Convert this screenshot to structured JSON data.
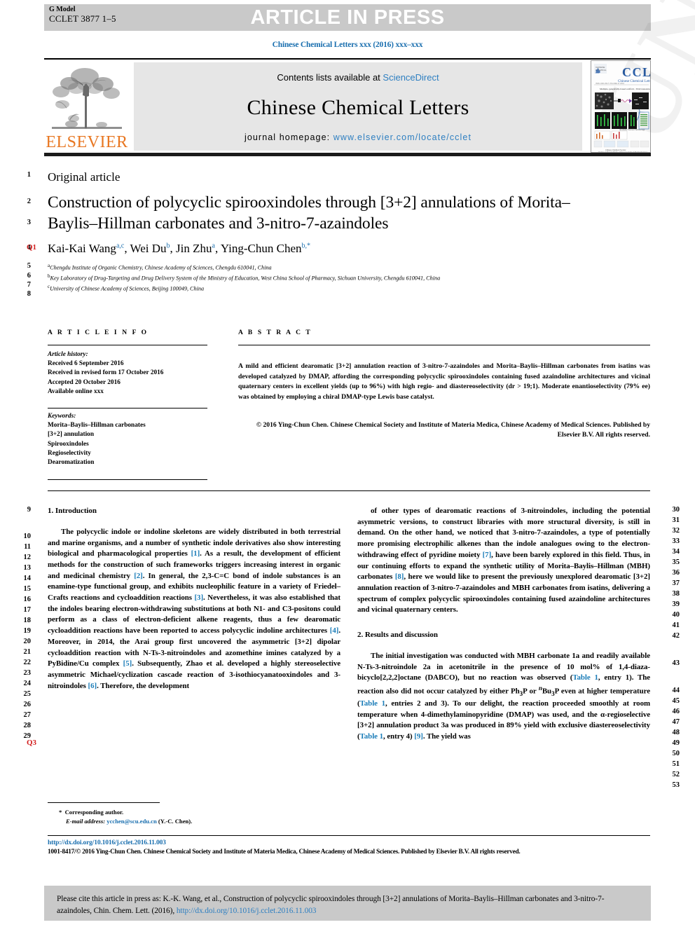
{
  "header": {
    "g_model_label": "G Model",
    "g_model_code": "CCLET 3877 1–5",
    "article_in_press": "ARTICLE IN PRESS",
    "journal_ref": "Chinese Chemical Letters xxx (2016) xxx–xxx"
  },
  "masthead": {
    "contents_prefix": "Contents lists available at ",
    "contents_link": "ScienceDirect",
    "journal_name": "Chinese Chemical Letters",
    "homepage_prefix": "journal homepage: ",
    "homepage_link": "www.elsevier.com/locate/cclet",
    "publisher_logo_text": "ELSEVIER",
    "cover_title": "CCL",
    "cover_subtitle": "Chinese Chemical Letters"
  },
  "article": {
    "type_label": "Original article",
    "title": "Construction of polycyclic spirooxindoles through [3+2] annulations of Morita–Baylis–Hillman carbonates and 3-nitro-7-azaindoles",
    "authors_html": "Kai-Kai Wang<sup>a,c</sup>, Wei Du<sup>b</sup>, Jin Zhu<sup>a</sup>, Ying-Chun Chen<sup>b,*</sup>",
    "affiliations": [
      {
        "marker": "a",
        "text": "Chengdu Institute of Organic Chemistry, Chinese Academy of Sciences, Chengdu 610041, China"
      },
      {
        "marker": "b",
        "text": "Key Laboratory of Drug-Targeting and Drug Delivery System of the Ministry of Education, West China School of Pharmacy, Sichuan University, Chengdu 610041, China"
      },
      {
        "marker": "c",
        "text": "University of Chinese Academy of Sciences, Beijing 100049, China"
      }
    ]
  },
  "article_info": {
    "heading": "A R T I C L E  I N F O",
    "history_label": "Article history:",
    "history": [
      "Received 6 September 2016",
      "Received in revised form 17 October 2016",
      "Accepted 20 October 2016",
      "Available online xxx"
    ],
    "keywords_label": "Keywords:",
    "keywords": [
      "Morita–Baylis–Hillman carbonates",
      "[3+2] annulation",
      "Spirooxindoles",
      "Regioselectivity",
      "Dearomatization"
    ]
  },
  "abstract": {
    "heading": "A B S T R A C T",
    "text": "A mild and efficient dearomatic [3+2] annulation reaction of 3-nitro-7-azaindoles and Morita–Baylis–Hillman carbonates from isatins was developed catalyzed by DMAP, affording the corresponding polycyclic spirooxindoles containing fused azaindoline architectures and vicinal quaternary centers in excellent yields (up to 96%) with high regio- and diastereoselectivity (dr > 19;1). Moderate enantioselectivity (79% ee) was obtained by employing a chiral DMAP-type Lewis base catalyst.",
    "copyright": "© 2016 Ying-Chun Chen. Chinese Chemical Society and Institute of Materia Medica, Chinese Academy of Medical Sciences. Published by Elsevier B.V. All rights reserved."
  },
  "body": {
    "intro_heading": "1. Introduction",
    "intro_p1": "The polycyclic indole or indoline skeletons are widely distributed in both terrestrial and marine organisms, and a number of synthetic indole derivatives also show interesting biological and pharmacological properties [1]. As a result, the development of efficient methods for the construction of such frameworks triggers increasing interest in organic and medicinal chemistry [2]. In general, the 2,3-C=C bond of indole substances is an enamine-type functional group, and exhibits nucleophilic feature in a variety of Friedel–Crafts reactions and cycloaddition reactions [3]. Nevertheless, it was also established that the indoles bearing electron-withdrawing substitutions at both N1- and C3-positons could perform as a class of electron-deficient alkene reagents, thus a few dearomatic cycloaddition reactions have been reported to access polycyclic indoline architectures [4]. Moreover, in 2014, the Arai group first uncovered the asymmetric [3+2] dipolar cycloaddition reaction with N-Ts-3-nitroindoles and azomethine imines catalyzed by a PyBidine/Cu complex [5]. Subsequently, Zhao et al. developed a highly stereoselective asymmetric Michael/cyclization cascade reaction of 3-isothiocyanatooxindoles and 3-nitroindoles [6]. Therefore, the development",
    "intro_p1_cont": "of other types of dearomatic reactions of 3-nitroindoles, including the potential asymmetric versions, to construct libraries with more structural diversity, is still in demand. On the other hand, we noticed that 3-nitro-7-azaindoles, a type of potentially more promising electrophilic alkenes than the indole analogues owing to the electron-withdrawing effect of pyridine moiety [7], have been barely explored in this field. Thus, in our continuing efforts to expand the synthetic utility of Morita–Baylis–Hillman (MBH) carbonates [8], here we would like to present the previously unexplored dearomatic [3+2] annulation reaction of 3-nitro-7-azaindoles and MBH carbonates from isatins, delivering a spectrum of complex polycyclic spirooxindoles containing fused azaindoline architectures and vicinal quaternary centers.",
    "results_heading": "2. Results and discussion",
    "results_p1": "The initial investigation was conducted with MBH carbonate 1a and readily available N-Ts-3-nitroindole 2a in acetonitrile in the presence of 10 mol% of 1,4-diaza-bicyclo[2,2,2]octane (DABCO), but no reaction was observed (Table 1, entry 1). The reaction also did not occur catalyzed by either Ph3P or nBu3P even at higher temperature (Table 1, entries 2 and 3). To our delight, the reaction proceeded smoothly at room temperature when 4-dimethylaminopyridine (DMAP) was used, and the α-regioselective [3+2] annulation product 3a was produced in 89% yield with exclusive diastereoselectivity (Table 1, entry 4) [9]. The yield was"
  },
  "footnote": {
    "marker": "*",
    "corresponding": "Corresponding author.",
    "email_label": "E-mail address:",
    "email": "ycchen@scu.edu.cn",
    "email_suffix": "(Y.-C. Chen)."
  },
  "footer": {
    "doi": "http://dx.doi.org/10.1016/j.cclet.2016.11.003",
    "copyright": "1001-8417/© 2016 Ying-Chun Chen. Chinese Chemical Society and Institute of Materia Medica, Chinese Academy of Medical Sciences. Published by Elsevier B.V. All rights reserved."
  },
  "cite_box": {
    "text": "Please cite this article in press as: K.-K. Wang, et al., Construction of polycyclic spirooxindoles through [3+2] annulations of Morita–Baylis–Hillman carbonates and 3-nitro-7-azaindoles, Chin. Chem. Lett. (2016), ",
    "link": "http://dx.doi.org/10.1016/j.cclet.2016.11.003"
  },
  "line_numbers": {
    "left_title": [
      "1",
      "2",
      "3",
      "4",
      "5",
      "6",
      "7",
      "8"
    ],
    "left_body": [
      "9",
      "10",
      "11",
      "12",
      "13",
      "14",
      "15",
      "16",
      "17",
      "18",
      "19",
      "20",
      "21",
      "22",
      "23",
      "24",
      "25",
      "26",
      "27",
      "28",
      "29"
    ],
    "right_body": [
      "30",
      "31",
      "32",
      "33",
      "34",
      "35",
      "36",
      "37",
      "38",
      "39",
      "40",
      "41",
      "42",
      "43",
      "44",
      "45",
      "46",
      "47",
      "48",
      "49",
      "50",
      "51",
      "52",
      "53"
    ],
    "query_tags": [
      "Q1",
      "Q3"
    ]
  },
  "watermark": {
    "text": "UNCORRECTED PROOF"
  },
  "colors": {
    "link": "#2e7fc1",
    "ref_link": "#1a7cb8",
    "elsevier_orange": "#e87722",
    "banner_gray": "#c9c9c9",
    "masthead_gray": "#e6e6e6",
    "query_red": "#d21b1b"
  }
}
